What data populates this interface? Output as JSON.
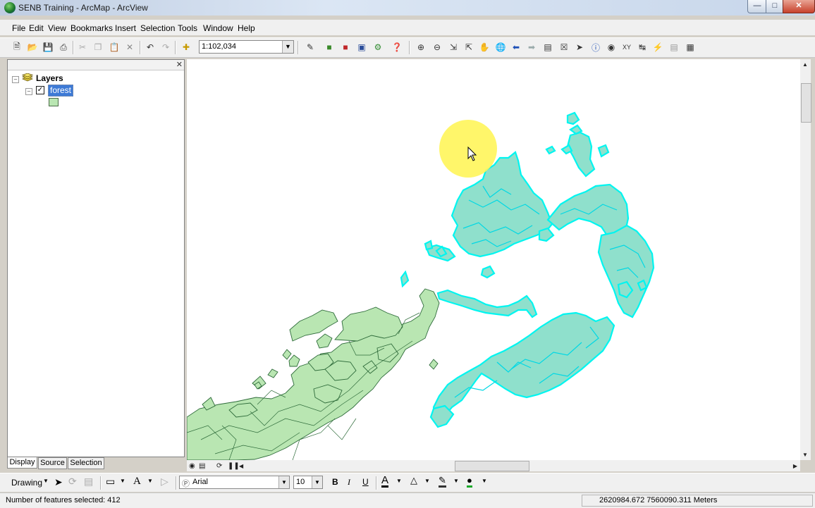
{
  "window": {
    "title": "SENB Training - ArcMap - ArcView"
  },
  "menu": [
    "File",
    "Edit",
    "View",
    "Bookmarks",
    "Insert",
    "Selection",
    "Tools",
    "Window",
    "Help"
  ],
  "toolbar": {
    "scale": "1:102,034"
  },
  "toc": {
    "root_label": "Layers",
    "layer_label": "forest",
    "layer_checked": "✓",
    "tabs": [
      "Display",
      "Source",
      "Selection"
    ]
  },
  "drawing": {
    "menu_label": "Drawing",
    "font_name": "Arial",
    "font_size": "10",
    "bold": "B",
    "italic": "I",
    "underline": "U",
    "text_tool": "A"
  },
  "status": {
    "message": "Number of features selected: 412",
    "coordinates": "2620984.672  7560090.311 Meters"
  },
  "colors": {
    "selected_feature": "#00f5f0",
    "feature_fill": "#b9e6b2",
    "feature_outline": "#2e6b3a"
  }
}
